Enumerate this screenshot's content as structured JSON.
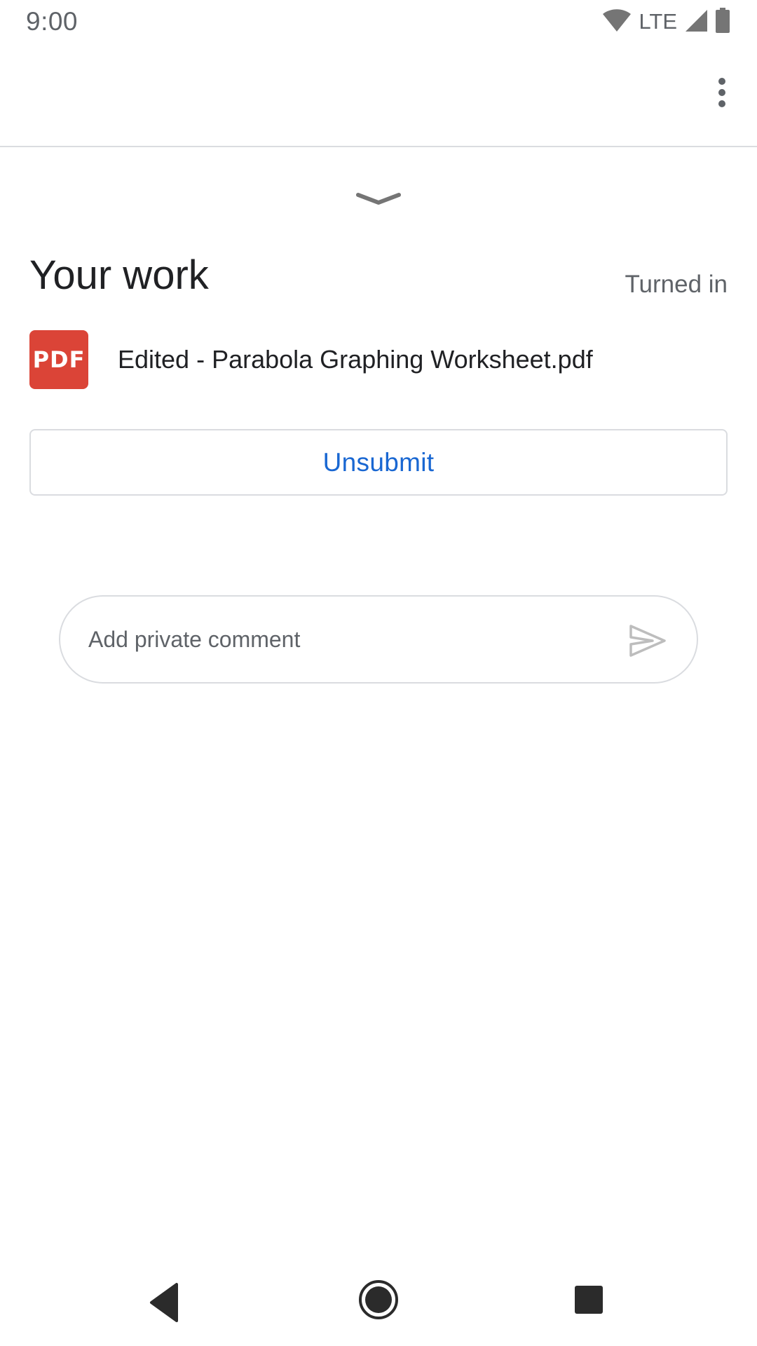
{
  "status_bar": {
    "time": "9:00",
    "network": "LTE",
    "icons": [
      "wifi-icon",
      "cell-signal-icon",
      "battery-icon"
    ]
  },
  "app_bar": {
    "overflow_icon": "more-vert-icon"
  },
  "your_work": {
    "title": "Your work",
    "status": "Turned in",
    "attachment": {
      "icon_label": "PDF",
      "file_name": "Edited - Parabola Graphing Worksheet.pdf"
    },
    "unsubmit_label": "Unsubmit"
  },
  "private_comment": {
    "placeholder": "Add private comment",
    "value": ""
  },
  "colors": {
    "accent": "#1967d2",
    "pdf_red": "#db4437",
    "divider": "#dadce0",
    "secondary_text": "#5f6368"
  }
}
